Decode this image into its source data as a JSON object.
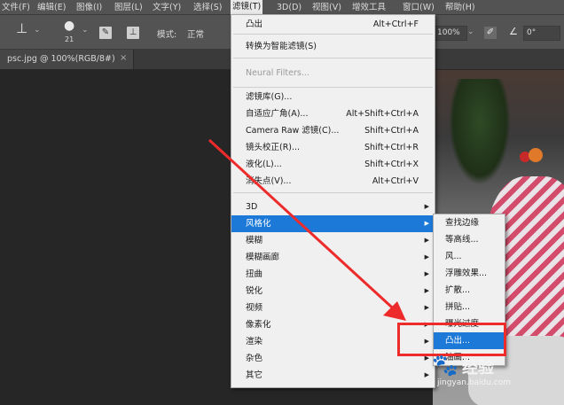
{
  "menubar": {
    "items": [
      "文件(F)",
      "编辑(E)",
      "图像(I)",
      "图层(L)",
      "文字(Y)",
      "选择(S)",
      "滤镜(T)",
      "3D(D)",
      "视图(V)",
      "增效工具",
      "窗口(W)",
      "帮助(H)"
    ]
  },
  "options": {
    "brush_size": "21",
    "mode_label": "模式:",
    "mode_value": "正常",
    "flow_value": "100%",
    "angle_value": "0°"
  },
  "document_tab": {
    "title": "psc.jpg @ 100%(RGB/8#)",
    "close": "×"
  },
  "filter_menu": {
    "items": [
      {
        "label": "凸出",
        "shortcut": "Alt+Ctrl+F"
      },
      {
        "label": "转换为智能滤镜(S)",
        "shortcut": ""
      },
      {
        "label": "Neural Filters...",
        "shortcut": ""
      },
      {
        "label": "滤镜库(G)...",
        "shortcut": ""
      },
      {
        "label": "自适应广角(A)...",
        "shortcut": "Alt+Shift+Ctrl+A"
      },
      {
        "label": "Camera Raw 滤镜(C)...",
        "shortcut": "Shift+Ctrl+A"
      },
      {
        "label": "镜头校正(R)...",
        "shortcut": "Shift+Ctrl+R"
      },
      {
        "label": "液化(L)...",
        "shortcut": "Shift+Ctrl+X"
      },
      {
        "label": "消失点(V)...",
        "shortcut": "Alt+Ctrl+V"
      },
      {
        "label": "3D",
        "shortcut": ""
      },
      {
        "label": "风格化",
        "shortcut": ""
      },
      {
        "label": "模糊",
        "shortcut": ""
      },
      {
        "label": "模糊画廊",
        "shortcut": ""
      },
      {
        "label": "扭曲",
        "shortcut": ""
      },
      {
        "label": "锐化",
        "shortcut": ""
      },
      {
        "label": "视频",
        "shortcut": ""
      },
      {
        "label": "像素化",
        "shortcut": ""
      },
      {
        "label": "渲染",
        "shortcut": ""
      },
      {
        "label": "杂色",
        "shortcut": ""
      },
      {
        "label": "其它",
        "shortcut": ""
      }
    ]
  },
  "stylize_submenu": {
    "items": [
      "查找边缘",
      "等高线...",
      "风...",
      "浮雕效果...",
      "扩散...",
      "拼贴...",
      "曝光过度",
      "凸出...",
      "油画..."
    ]
  },
  "watermark": {
    "title": "经验",
    "url": "jingyan.baidu.com"
  },
  "colors": {
    "highlight": "#1c79d8",
    "annotation": "#ee2b2b"
  }
}
